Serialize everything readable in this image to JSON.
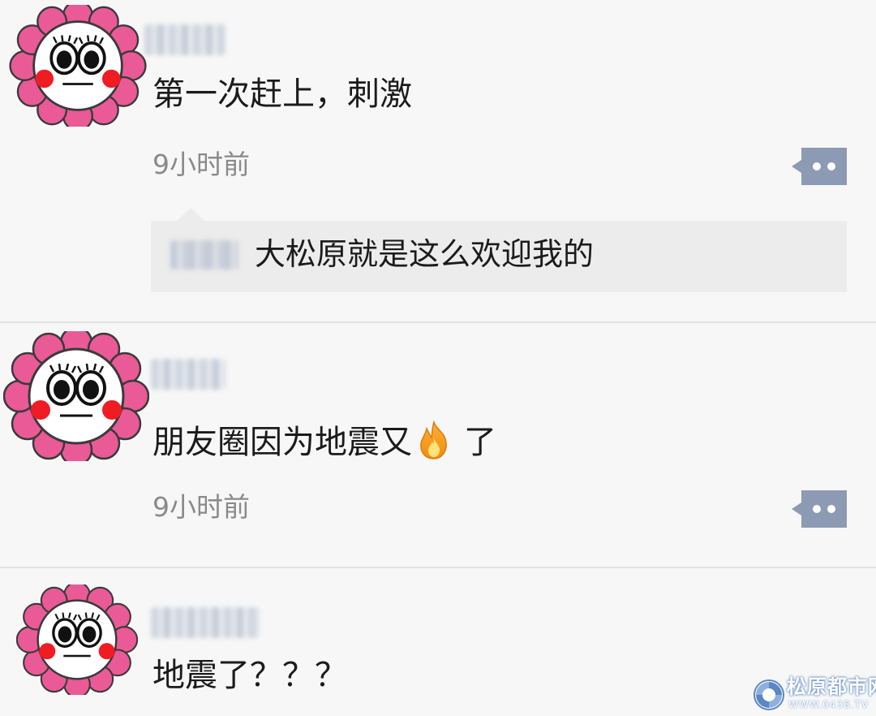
{
  "posts": [
    {
      "content": "第一次赶上，刺激",
      "time": "9小时前",
      "reply": {
        "text": "大松原就是这么欢迎我的"
      }
    },
    {
      "content_before": "朋友圈因为地震又",
      "emoji": "fire-icon",
      "content_after": "了",
      "time": "9小时前"
    },
    {
      "content": "地震了？？？"
    }
  ],
  "watermark": {
    "title": "松原都市网",
    "url": "WWW.0438.TV"
  },
  "colors": {
    "background": "#f7f7f7",
    "more_button": "#8c9ab3",
    "reply_background": "#ececec",
    "avatar_petal": "#ea5a96",
    "avatar_cheek": "#ef1c24"
  }
}
